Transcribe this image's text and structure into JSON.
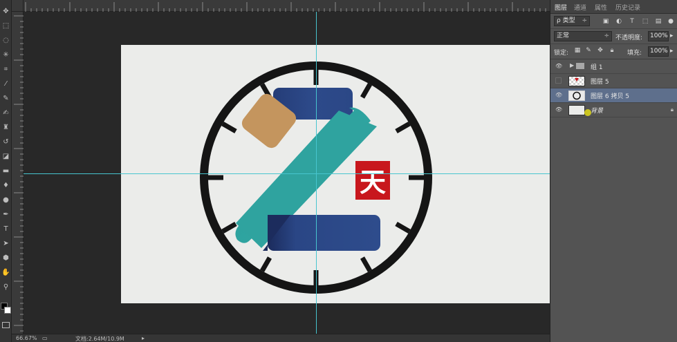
{
  "toolbox": {
    "tools": [
      {
        "name": "move-tool-icon",
        "glyph": "✥"
      },
      {
        "name": "marquee-tool-icon",
        "glyph": "⬚"
      },
      {
        "name": "lasso-tool-icon",
        "glyph": "◌"
      },
      {
        "name": "magic-wand-tool-icon",
        "glyph": "✳"
      },
      {
        "name": "crop-tool-icon",
        "glyph": "⌗"
      },
      {
        "name": "eyedropper-tool-icon",
        "glyph": "⁄"
      },
      {
        "name": "healing-brush-tool-icon",
        "glyph": "✎"
      },
      {
        "name": "brush-tool-icon",
        "glyph": "✍"
      },
      {
        "name": "clone-stamp-tool-icon",
        "glyph": "♜"
      },
      {
        "name": "history-brush-tool-icon",
        "glyph": "↺"
      },
      {
        "name": "eraser-tool-icon",
        "glyph": "◪"
      },
      {
        "name": "gradient-tool-icon",
        "glyph": "▬"
      },
      {
        "name": "blur-tool-icon",
        "glyph": "♦"
      },
      {
        "name": "dodge-tool-icon",
        "glyph": "●"
      },
      {
        "name": "pen-tool-icon",
        "glyph": "✒"
      },
      {
        "name": "type-tool-icon",
        "glyph": "T"
      },
      {
        "name": "path-selection-tool-icon",
        "glyph": "➤"
      },
      {
        "name": "shape-tool-icon",
        "glyph": "⬢"
      },
      {
        "name": "hand-tool-icon",
        "glyph": "✋"
      },
      {
        "name": "zoom-tool-icon",
        "glyph": "⚲"
      }
    ]
  },
  "statusbar": {
    "zoom": "66.67%",
    "doc_info": "文档:2.64M/10.9M"
  },
  "panel": {
    "tabs": [
      "图层",
      "通道",
      "属性",
      "历史记录"
    ],
    "filter": {
      "kind_label": "ρ 类型",
      "arrow": "÷"
    },
    "blend": {
      "mode": "正常",
      "opacity_label": "不透明度:",
      "opacity_value": "100%"
    },
    "lock": {
      "label": "锁定:",
      "fill_label": "填充:",
      "fill_value": "100%"
    },
    "layers": [
      {
        "name": "组 1",
        "visible": true,
        "type": "group"
      },
      {
        "name": "图层 5",
        "visible": false,
        "type": "layer"
      },
      {
        "name": "图层 6 拷贝 5",
        "visible": true,
        "type": "layer",
        "selected": true
      },
      {
        "name": "背景",
        "visible": true,
        "type": "background",
        "locked": true
      }
    ]
  },
  "artwork": {
    "logo_char": "天",
    "colors": {
      "ring": "#151515",
      "navy": "#2d4a8a",
      "teal": "#2fa39f",
      "tan": "#c4955e",
      "red": "#c8171d",
      "canvas": "#ebecea",
      "guide": "#47c5cf"
    }
  }
}
